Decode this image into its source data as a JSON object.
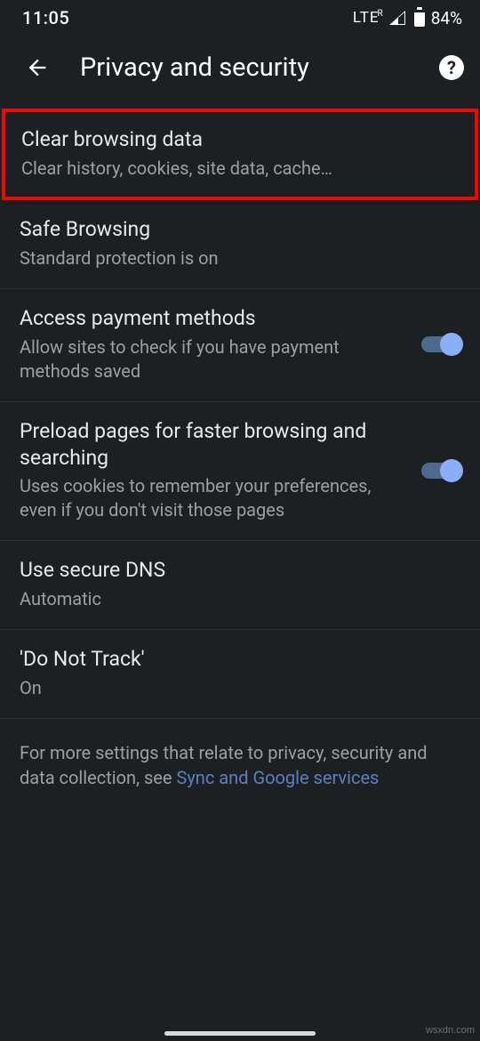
{
  "status": {
    "time": "11:05",
    "network": "LTE",
    "network_sup": "R",
    "battery_pct": "84%"
  },
  "header": {
    "title": "Privacy and security"
  },
  "settings": [
    {
      "title": "Clear browsing data",
      "subtitle": "Clear history, cookies, site data, cache…",
      "highlighted": true,
      "toggle": null
    },
    {
      "title": "Safe Browsing",
      "subtitle": "Standard protection is on",
      "toggle": null
    },
    {
      "title": "Access payment methods",
      "subtitle": "Allow sites to check if you have payment methods saved",
      "toggle": true
    },
    {
      "title": "Preload pages for faster browsing and searching",
      "subtitle": "Uses cookies to remember your preferences, even if you don't visit those pages",
      "toggle": true
    },
    {
      "title": "Use secure DNS",
      "subtitle": "Automatic",
      "toggle": null
    },
    {
      "title": "'Do Not Track'",
      "subtitle": "On",
      "toggle": null
    }
  ],
  "footer": {
    "prefix": "For more settings that relate to privacy, security and data collection, see ",
    "link": "Sync and Google services"
  },
  "watermark": "wsxdn.com"
}
